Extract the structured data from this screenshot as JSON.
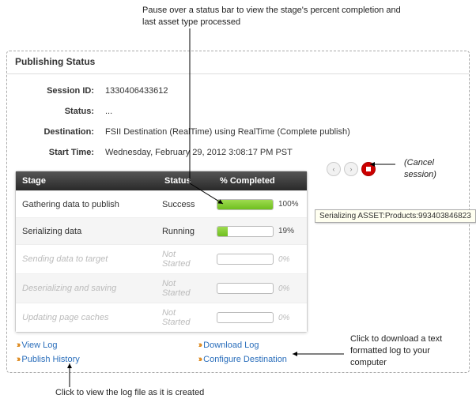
{
  "annotations": {
    "top": "Pause over a status bar to view the stage's percent completion and last asset type processed",
    "cancel": "(Cancel session)",
    "download": "Click to download a text formatted log to your computer",
    "viewlog": "Click to view the log file as it is created"
  },
  "panel": {
    "title": "Publishing Status"
  },
  "meta": {
    "sessionIdLabel": "Session ID:",
    "sessionId": "1330406433612",
    "statusLabel": "Status:",
    "status": "...",
    "destinationLabel": "Destination:",
    "destination": "FSII Destination (RealTime) using RealTime (Complete publish)",
    "startTimeLabel": "Start Time:",
    "startTime": "Wednesday, February 29, 2012 3:08:17 PM PST"
  },
  "headers": {
    "stage": "Stage",
    "status": "Status",
    "pct": "% Completed"
  },
  "rows": [
    {
      "stage": "Gathering data to publish",
      "status": "Success",
      "pct": 100,
      "pctLabel": "100%",
      "faded": false
    },
    {
      "stage": "Serializing data",
      "status": "Running",
      "pct": 19,
      "pctLabel": "19%",
      "faded": false
    },
    {
      "stage": "Sending data to target",
      "status": "Not Started",
      "pct": 0,
      "pctLabel": "0%",
      "faded": true
    },
    {
      "stage": "Deserializing and saving",
      "status": "Not Started",
      "pct": 0,
      "pctLabel": "0%",
      "faded": true
    },
    {
      "stage": "Updating page caches",
      "status": "Not Started",
      "pct": 0,
      "pctLabel": "0%",
      "faded": true
    }
  ],
  "tooltip": "Serializing ASSET:Products:993403846823",
  "links": {
    "viewLog": "View Log",
    "publishHistory": "Publish History",
    "downloadLog": "Download Log",
    "configureDestination": "Configure Destination"
  }
}
